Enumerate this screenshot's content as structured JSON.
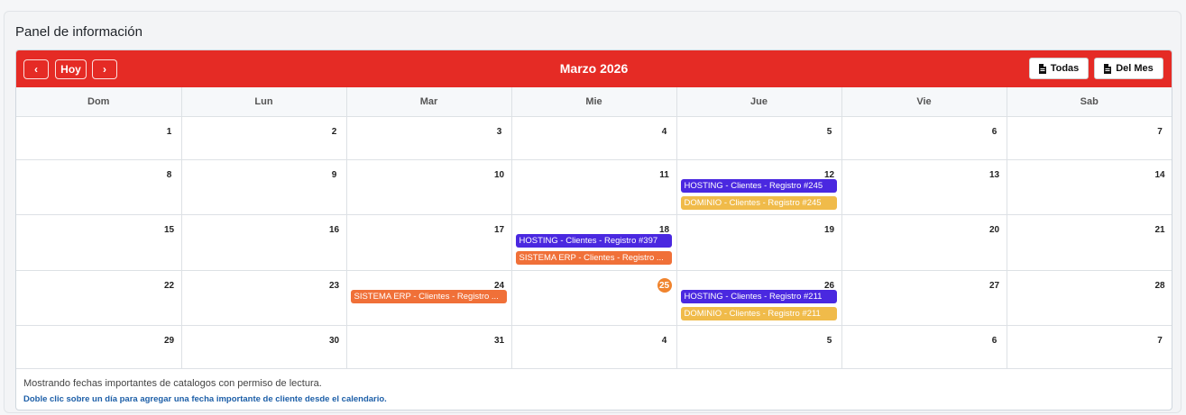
{
  "panel_title": "Panel de información",
  "toolbar": {
    "prev_icon": "chevron-left-icon",
    "prev_label": "‹",
    "today_label": "Hoy",
    "next_icon": "chevron-right-icon",
    "next_label": "›",
    "month_title": "Marzo 2026",
    "all_label": "Todas",
    "month_label": "Del Mes",
    "pdf_icon": "pdf-icon"
  },
  "colors": {
    "header": "#e52b25",
    "hosting": "#4a28e0",
    "dominio": "#f0bb4a",
    "erp": "#f07038",
    "today": "#f0842e"
  },
  "weekdays": [
    "Dom",
    "Lun",
    "Mar",
    "Mie",
    "Jue",
    "Vie",
    "Sab"
  ],
  "weeks": [
    [
      {
        "day": "1",
        "type": "weekend",
        "events": []
      },
      {
        "day": "2",
        "type": "normal",
        "events": []
      },
      {
        "day": "3",
        "type": "normal",
        "events": []
      },
      {
        "day": "4",
        "type": "normal",
        "events": []
      },
      {
        "day": "5",
        "type": "normal",
        "events": []
      },
      {
        "day": "6",
        "type": "normal",
        "events": []
      },
      {
        "day": "7",
        "type": "weekend",
        "events": []
      }
    ],
    [
      {
        "day": "8",
        "type": "weekend",
        "events": []
      },
      {
        "day": "9",
        "type": "normal",
        "events": []
      },
      {
        "day": "10",
        "type": "normal",
        "events": []
      },
      {
        "day": "11",
        "type": "normal",
        "events": []
      },
      {
        "day": "12",
        "type": "normal",
        "events": [
          {
            "label": "HOSTING - Clientes - Registro #245",
            "kind": "hosting"
          },
          {
            "label": "DOMINIO - Clientes - Registro #245",
            "kind": "dominio"
          }
        ]
      },
      {
        "day": "13",
        "type": "normal",
        "events": []
      },
      {
        "day": "14",
        "type": "weekend",
        "events": []
      }
    ],
    [
      {
        "day": "15",
        "type": "weekend",
        "events": []
      },
      {
        "day": "16",
        "type": "normal",
        "events": []
      },
      {
        "day": "17",
        "type": "normal",
        "events": []
      },
      {
        "day": "18",
        "type": "normal",
        "events": [
          {
            "label": "HOSTING - Clientes - Registro #397",
            "kind": "hosting"
          },
          {
            "label": "SISTEMA ERP - Clientes - Registro ...",
            "kind": "erp"
          }
        ]
      },
      {
        "day": "19",
        "type": "normal",
        "events": []
      },
      {
        "day": "20",
        "type": "normal",
        "events": []
      },
      {
        "day": "21",
        "type": "weekend",
        "events": []
      }
    ],
    [
      {
        "day": "22",
        "type": "weekend",
        "events": []
      },
      {
        "day": "23",
        "type": "normal",
        "events": []
      },
      {
        "day": "24",
        "type": "normal",
        "events": [
          {
            "label": "SISTEMA ERP - Clientes - Registro ...",
            "kind": "erp"
          }
        ]
      },
      {
        "day": "25",
        "type": "today",
        "events": []
      },
      {
        "day": "26",
        "type": "normal",
        "events": [
          {
            "label": "HOSTING - Clientes - Registro #211",
            "kind": "hosting"
          },
          {
            "label": "DOMINIO - Clientes - Registro #211",
            "kind": "dominio"
          }
        ]
      },
      {
        "day": "27",
        "type": "normal",
        "events": []
      },
      {
        "day": "28",
        "type": "weekend",
        "events": []
      }
    ],
    [
      {
        "day": "29",
        "type": "weekend",
        "events": []
      },
      {
        "day": "30",
        "type": "normal",
        "events": []
      },
      {
        "day": "31",
        "type": "normal",
        "events": []
      },
      {
        "day": "4",
        "type": "other",
        "events": []
      },
      {
        "day": "5",
        "type": "other",
        "events": []
      },
      {
        "day": "6",
        "type": "other",
        "events": []
      },
      {
        "day": "7",
        "type": "other",
        "events": []
      }
    ]
  ],
  "footer": {
    "note": "Mostrando fechas importantes de catalogos con permiso de lectura.",
    "hint": "Doble clic sobre un día para agregar una fecha importante de cliente desde el calendario."
  }
}
